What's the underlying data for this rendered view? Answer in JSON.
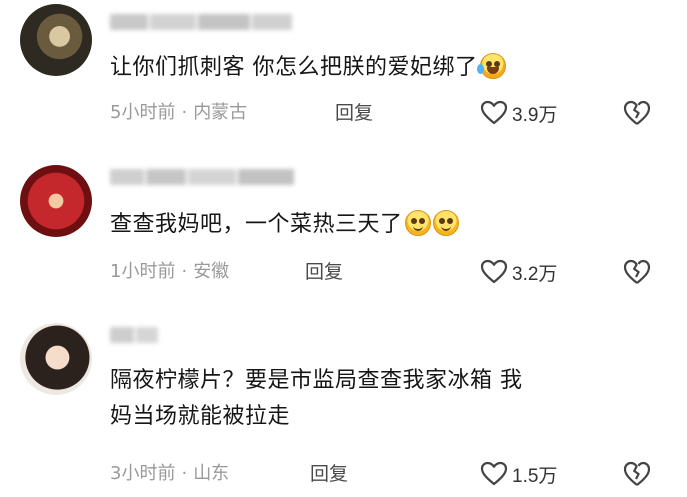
{
  "comments": [
    {
      "text": "让你们抓刺客 你怎么把朕的爱妃绑了",
      "emojis": [
        "laugh-with-tears-icon"
      ],
      "time": "5小时前",
      "location": "内蒙古",
      "reply_label": "回复",
      "likes": "3.9万"
    },
    {
      "text": "查查我妈吧，一个菜热三天了",
      "emojis": [
        "smile-icon",
        "smile-icon"
      ],
      "time": "1小时前",
      "location": "安徽",
      "reply_label": "回复",
      "likes": "3.2万"
    },
    {
      "text_line1": "隔夜柠檬片？要是市监局查查我家冰箱 我",
      "text_line2": "妈当场就能被拉走",
      "time": "3小时前",
      "location": "山东",
      "reply_label": "回复",
      "likes": "1.5万"
    }
  ],
  "separator": "·",
  "colors": {
    "text": "#161616",
    "meta": "#9a9a9a",
    "icon": "#444444"
  }
}
